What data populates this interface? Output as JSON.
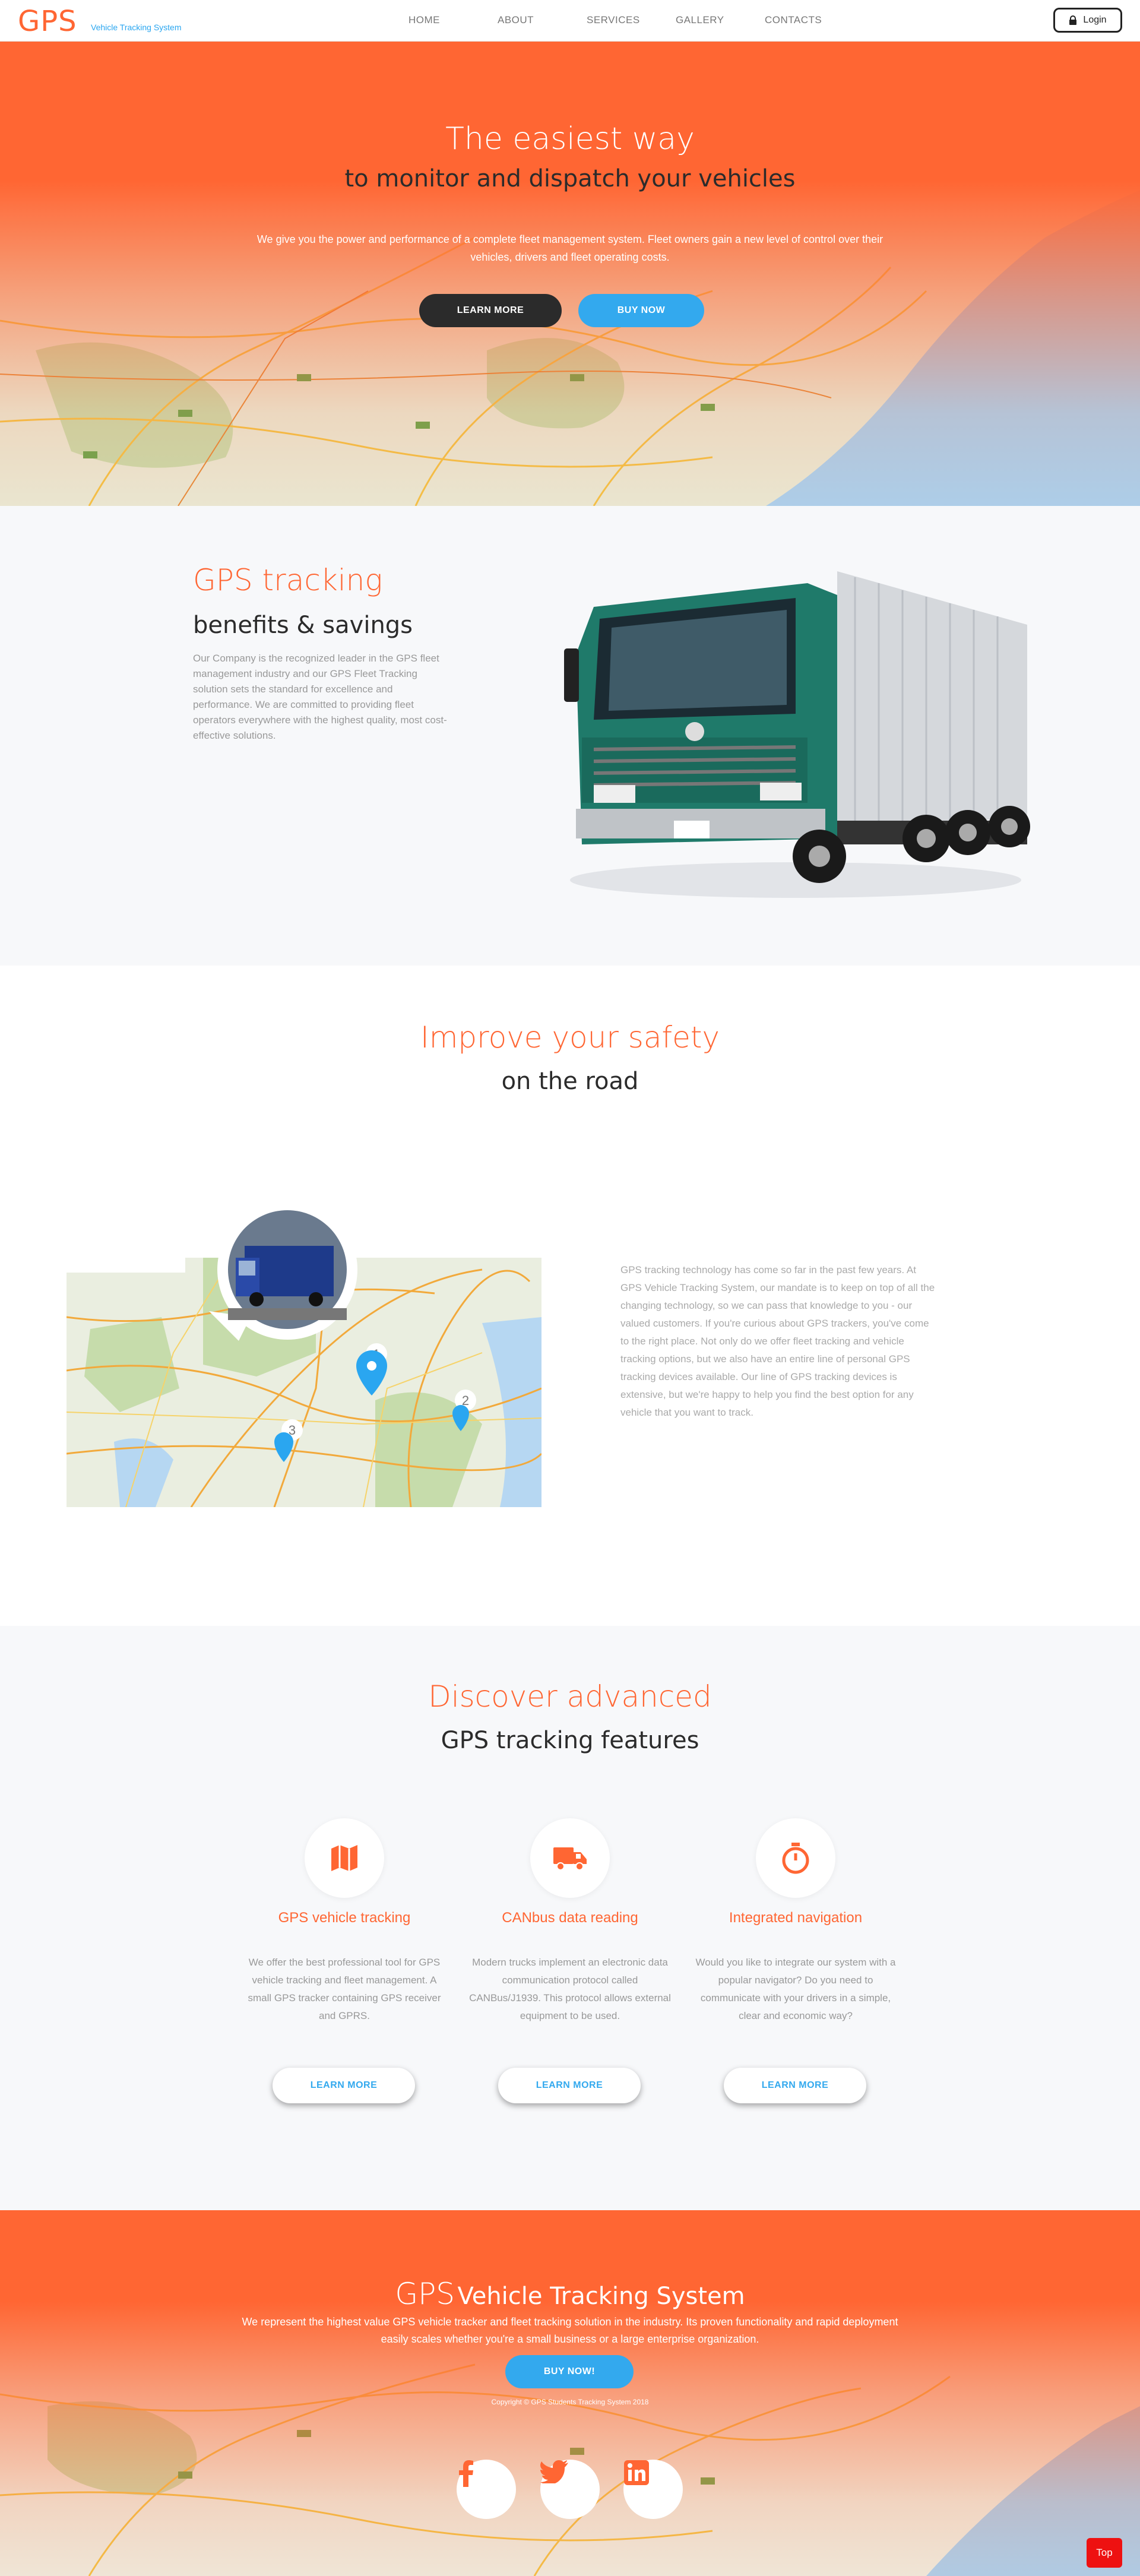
{
  "header": {
    "logo": "GPS",
    "logo_sub": "Vehicle Tracking System",
    "nav": [
      "HOME",
      "ABOUT",
      "SERVICES",
      "GALLERY",
      "CONTACTS"
    ],
    "login": "Login"
  },
  "hero": {
    "title": "The easiest way",
    "subtitle": "to monitor and dispatch your vehicles",
    "text": "We give you the power and performance of a complete fleet management system. Fleet owners gain a new level of control over their vehicles, drivers and fleet operating costs.",
    "learn_more": "LEARN MORE",
    "buy_now": "BUY NOW"
  },
  "benefits": {
    "title": "GPS tracking",
    "subtitle": "benefits & savings",
    "text": "Our Company is the recognized leader in the GPS fleet management industry and our GPS Fleet Tracking solution sets the standard for excellence and performance. We are committed to providing fleet operators everywhere with the highest quality, most cost-effective solutions."
  },
  "safety": {
    "title": "Improve your safety",
    "subtitle": "on the road",
    "text": "GPS tracking technology has come so far in the past few years. At GPS Vehicle Tracking System, our mandate is to keep on top of all the changing technology, so we can pass that knowledge to you - our valued customers. If you're curious about GPS trackers, you've come to the right place. Not only do we offer fleet tracking and vehicle tracking options, but we also have an entire line of personal GPS tracking devices available. Our line of GPS tracking devices is extensive, but we're happy to help you find the best option for any vehicle that you want to track.",
    "markers": [
      "1",
      "2",
      "3"
    ]
  },
  "features": {
    "title": "Discover advanced",
    "subtitle": "GPS tracking features",
    "items": [
      {
        "icon": "map-icon",
        "title": "GPS vehicle tracking",
        "text": "We offer the best professional tool for GPS vehicle tracking and fleet management. A small GPS tracker containing GPS receiver and GPRS.",
        "button": "LEARN MORE"
      },
      {
        "icon": "truck-icon",
        "title": "CANbus data reading",
        "text": "Modern trucks implement an electronic data communication protocol called CANBus/J1939. This protocol allows external equipment to be used.",
        "button": "LEARN MORE"
      },
      {
        "icon": "stopwatch-icon",
        "title": "Integrated navigation",
        "text": "Would you like to integrate our system with a popular navigator? Do you need to communicate with your drivers in a simple, clear and economic way?",
        "button": "LEARN MORE"
      }
    ]
  },
  "footer": {
    "brand_gps": "GPS",
    "brand_rest": "Vehicle Tracking System",
    "text": "We represent the highest value GPS vehicle tracker and fleet tracking solution in the industry. Its proven functionality and rapid deployment easily scales whether you're a small business or a large enterprise organization.",
    "buy_now": "BUY NOW!",
    "copyright": "Copyright © GPS Students Tracking System 2018",
    "social": [
      "facebook-icon",
      "twitter-icon",
      "linkedin-icon"
    ],
    "top": "Top"
  },
  "colors": {
    "accent": "#ff6633",
    "blue": "#33a9ee",
    "dark": "#2b2b2b",
    "truck_cab": "#1f7a6a",
    "top_button": "#ee1111"
  }
}
